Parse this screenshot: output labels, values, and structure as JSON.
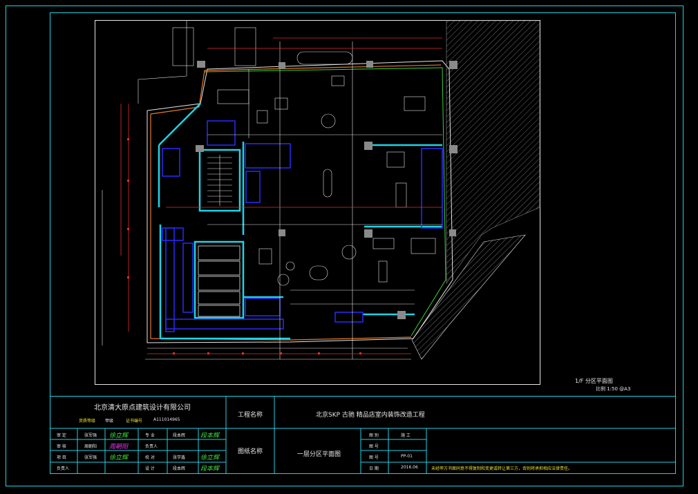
{
  "drawing": {
    "plan_label": "1/F 分区平面图",
    "scale_note": "比例 1:50 @A3",
    "colors": {
      "frame": "#1fd4e6",
      "walls": "#1fd4e6",
      "furniture": "#2a2aff",
      "dimension": "#e62e2e",
      "linework": "#e8e8e8",
      "hatch": "#8a8a8a",
      "finish": "#e87a2a",
      "green": "#39d439"
    }
  },
  "title_block": {
    "company": "北京清大原点建筑设计有限公司",
    "license_label": "资质等级",
    "license_value": "甲级",
    "cert_label": "证书编号",
    "cert_value": "A111014965",
    "project_label": "工程名称",
    "project_name": "北京SKP 古驰 精品店室内装饰改造工程",
    "drawing_name_label": "图纸名称",
    "drawing_name": "一层分区平面图",
    "roles_left": [
      {
        "role": "审 定",
        "name": "张军强"
      },
      {
        "role": "审 核",
        "name": "周朝阳"
      },
      {
        "role": "项 目",
        "name": "张军强"
      },
      {
        "role": "负责人",
        "name": ""
      }
    ],
    "signatures_left": [
      "徐立辉",
      "周朝阳",
      "徐立辉",
      ""
    ],
    "roles_mid": [
      {
        "role": "专 业",
        "name": "段本辉"
      },
      {
        "role": "负责人",
        "name": ""
      },
      {
        "role": "校 对",
        "name": "张学鑫"
      },
      {
        "role": "设 计",
        "name": "段本辉"
      }
    ],
    "signatures_mid": [
      "段本辉",
      "",
      "徐立辉",
      "段本辉"
    ],
    "info": [
      {
        "label": "图 别",
        "value": "施 工"
      },
      {
        "label": "图 号",
        "value": ""
      },
      {
        "label": "图 号",
        "value": "PP-01"
      },
      {
        "label": "日 期",
        "value": "2016.06"
      }
    ],
    "note": "未经甲方书面同意不得复制和变更或转让第三方，否则将承担相应法律责任。"
  }
}
